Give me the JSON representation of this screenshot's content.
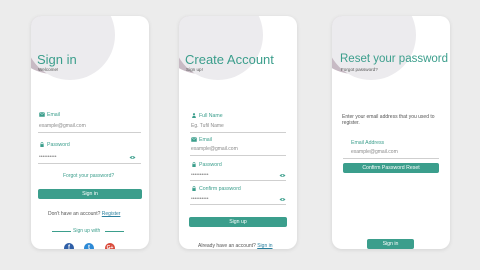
{
  "colors": {
    "accent": "#3b9e8c",
    "blob": "#c7bac4",
    "facebook": "#2f5fa7",
    "twitter": "#2d8ad6",
    "google": "#d9493a"
  },
  "signin": {
    "title": "Sign in",
    "subtitle": "Welcome!",
    "email_label": "Email",
    "email_value": "example@gmail.com",
    "password_label": "Password",
    "password_value": "••••••••••",
    "forgot": "Forgot your password?",
    "button": "Sign in",
    "no_account": "Don't have an account?",
    "register": "Register",
    "sign_up_with": "Sign up with",
    "social": {
      "facebook": "f",
      "twitter": "t",
      "google": "G+"
    }
  },
  "create": {
    "title": "Create Account",
    "subtitle": "Sign up!",
    "name_label": "Full Name",
    "name_value": "Eg. Tufil Name",
    "email_label": "Email",
    "email_value": "example@gmail.com",
    "password_label": "Password",
    "password_value": "••••••••••",
    "confirm_label": "Confirm password",
    "confirm_value": "••••••••••",
    "button": "Sign up",
    "have_account": "Already have an account?",
    "signin_link": "Sign in"
  },
  "reset": {
    "title": "Reset your password",
    "subtitle": "Forgot password?",
    "instructions": "Enter your email address that you used to register.",
    "email_label": "Email Address",
    "email_value": "example@gmail.com",
    "confirm_button": "Confirm Password Reset",
    "signin_button": "Sign in"
  }
}
